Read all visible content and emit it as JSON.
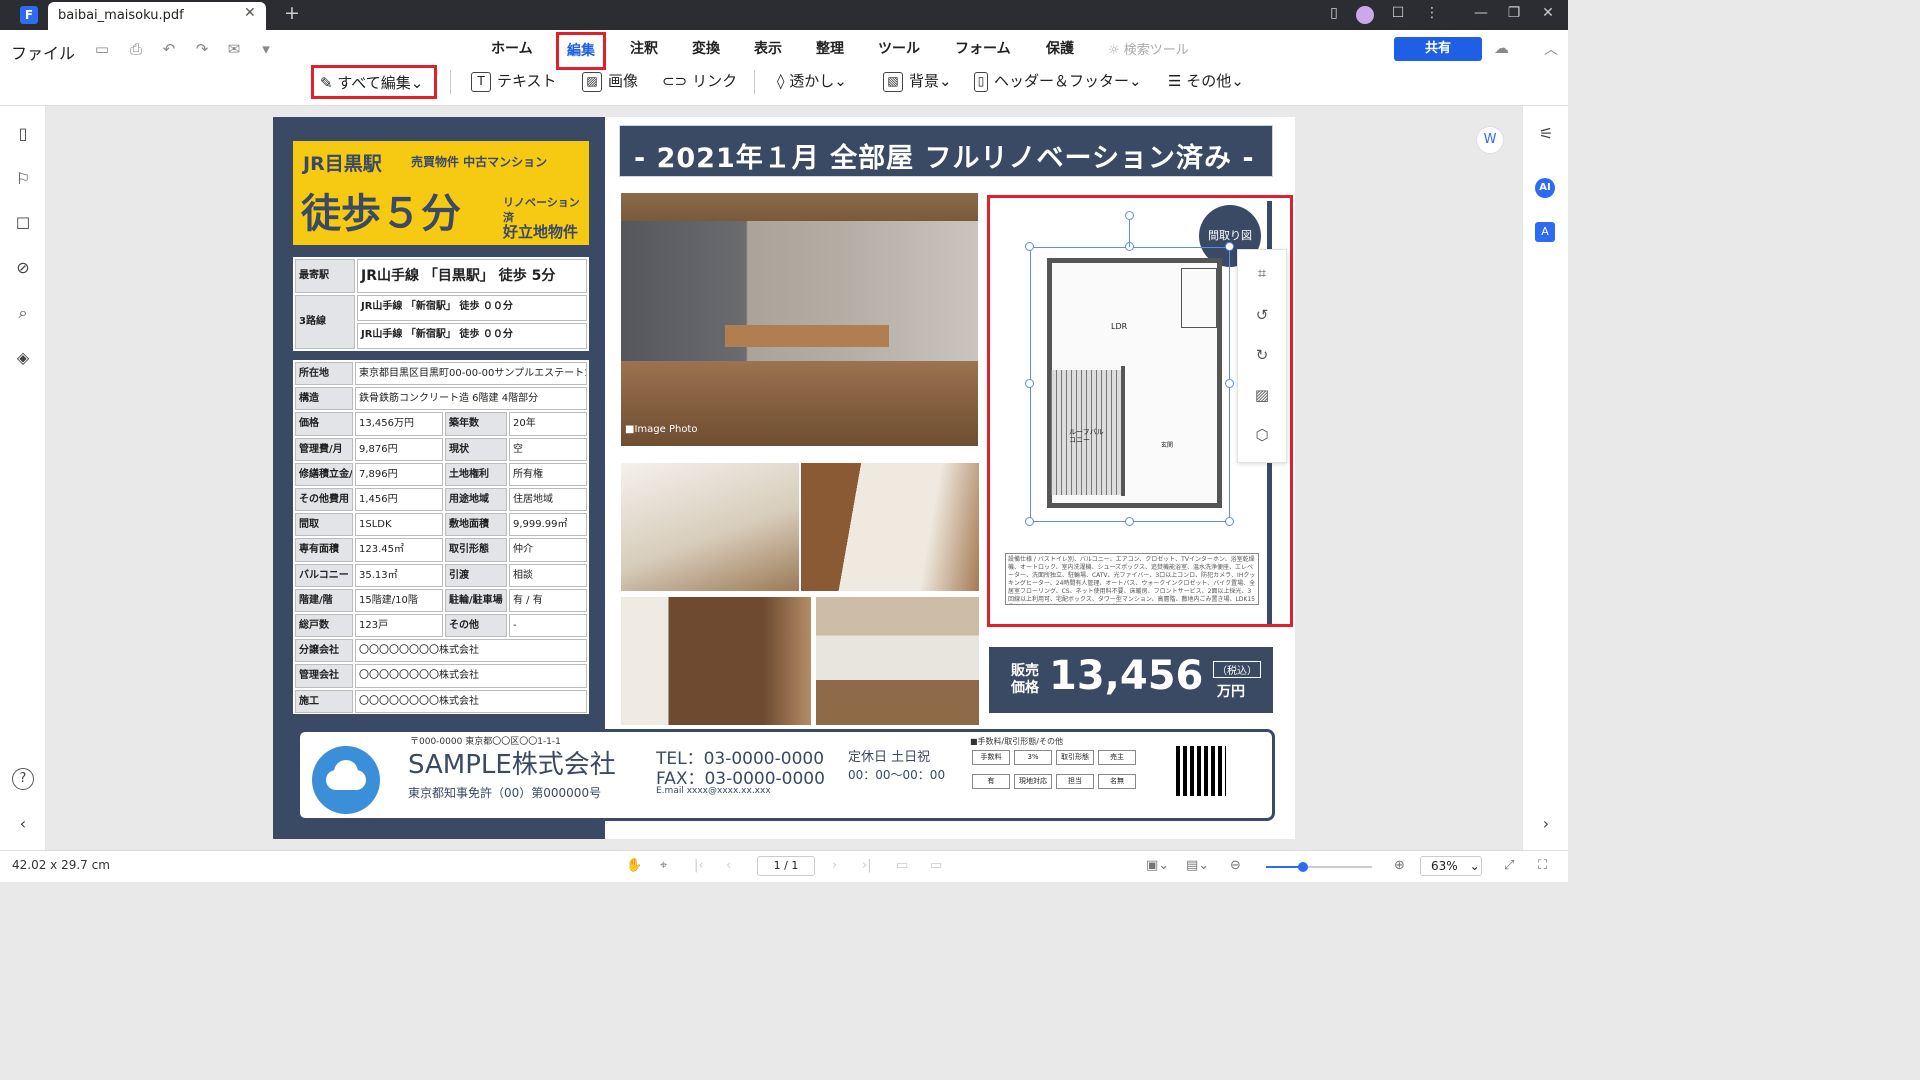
{
  "window": {
    "tab_title": "baibai_maisoku.pdf",
    "new_tab": "+"
  },
  "menu": {
    "file": "ファイル",
    "tabs": [
      "ホーム",
      "編集",
      "注釈",
      "変換",
      "表示",
      "整理",
      "ツール",
      "フォーム",
      "保護"
    ],
    "active_tab": "編集",
    "search_tools": "検索ツール",
    "share": "共有"
  },
  "ribbon": {
    "edit_all": "すべて編集",
    "text": "テキスト",
    "image": "画像",
    "link": "リンク",
    "watermark": "透かし",
    "background": "背景",
    "header_footer": "ヘッダー＆フッター",
    "other": "その他"
  },
  "right_icons": {
    "ai": "AI"
  },
  "doc": {
    "station_title": "JR目黒駅",
    "type_label": "売買物件 中古マンション",
    "walk": "徒歩５分",
    "renovated": "リノベーション済",
    "good_location": "好立地物件",
    "nearest_label": "最寄駅",
    "nearest_value": "JR山手線 「目黒駅」 徒歩 5分",
    "lines_label": "3路線",
    "line1": "JR山手線 「新宿駅」 徒歩 ００分",
    "line2": "JR山手線 「新宿駅」 徒歩 ００分",
    "headline": "- 2021年１月 全部屋 フルリノベーション済み -",
    "image_caption": "■Image Photo",
    "plan_badge": "間取り図",
    "plan_ldr": "LDR",
    "plan_roof": "ルーフバルコニー",
    "plan_entry": "玄関",
    "plan_notes": "設備仕様 / バストイレ別、バルコニー、エアコン、クロゼット、TVインターホン、浴室乾燥機、オートロック、室内洗濯機、シューズボックス、追焚機能浴室、温水洗浄便座、エレベーター、洗面所独立、駐輪場、CATV、光ファイバー、3口以上コンロ、防犯カメラ、IHクッキングヒーター、24時間有人管理、オートバス、ウォークインクロゼット、バイク置場、全居室フローリング、CS、ネット使用料不要、床暖房、フロントサービス、2面以上採光、3回線以上利用可、宅配ボックス、タワー型マンション、高層階、敷地内ごみ置き場、LDK15畳以上、シューズWIC、BS、保証会社利用可",
    "price_label": "販売\n価格",
    "price": "13,456",
    "price_tax": "（税込）",
    "price_unit": "万円",
    "company_address": "〒000-0000 東京都〇〇区〇〇1-1-1",
    "company": "SAMPLE株式会社",
    "license": "東京都知事免許（00）第000000号",
    "tel": "TEL：03-0000-0000",
    "fax": "FAX：03-0000-0000",
    "email": "E.mail xxxx@xxxx.xx.xxx",
    "holiday": "定休日 土日祝",
    "hours": "00：00〜00：00",
    "fee_title": "■手数料/取引形態/その他",
    "fee_cells": [
      "手数料",
      "3%",
      "取引形態",
      "売主",
      "有",
      "現地対応",
      "担当",
      "名無"
    ],
    "specs": [
      {
        "l": "所在地",
        "v": "東京都目黒区目黒町00-00-00サンプルエステート101",
        "full": true
      },
      {
        "l": "構造",
        "v": "鉄骨鉄筋コンクリート造 6階建 4階部分",
        "full": true
      },
      {
        "l": "価格",
        "v": "13,456万円",
        "l2": "築年数",
        "v2": "20年"
      },
      {
        "l": "管理費/月",
        "v": "9,876円",
        "l2": "現状",
        "v2": "空"
      },
      {
        "l": "修繕積立金/月",
        "v": "7,896円",
        "l2": "土地権利",
        "v2": "所有権"
      },
      {
        "l": "その他費用",
        "v": "1,456円",
        "l2": "用途地域",
        "v2": "住居地域"
      },
      {
        "l": "間取",
        "v": "1SLDK",
        "l2": "敷地面積",
        "v2": "9,999.99㎡"
      },
      {
        "l": "専有面積",
        "v": "123.45㎡",
        "l2": "取引形態",
        "v2": "仲介"
      },
      {
        "l": "バルコニー",
        "v": "35.13㎡",
        "l2": "引渡",
        "v2": "相談"
      },
      {
        "l": "階建/階",
        "v": "15階建/10階",
        "l2": "駐輪/駐車場",
        "v2": "有 / 有"
      },
      {
        "l": "総戸数",
        "v": "123戸",
        "l2": "その他",
        "v2": "-"
      },
      {
        "l": "分譲会社",
        "v": "〇〇〇〇〇〇〇〇株式会社",
        "full": true
      },
      {
        "l": "管理会社",
        "v": "〇〇〇〇〇〇〇〇株式会社",
        "full": true
      },
      {
        "l": "施工",
        "v": "〇〇〇〇〇〇〇〇株式会社",
        "full": true
      }
    ]
  },
  "status": {
    "size": "42.02 x 29.7 cm",
    "page": "1 / 1",
    "zoom": "63%",
    "zoom_level": 0.35
  },
  "colors": {
    "accent": "#1f5fe6",
    "navy": "#3a4a64",
    "yellow": "#f6c913",
    "highlight": "#e0202a"
  }
}
